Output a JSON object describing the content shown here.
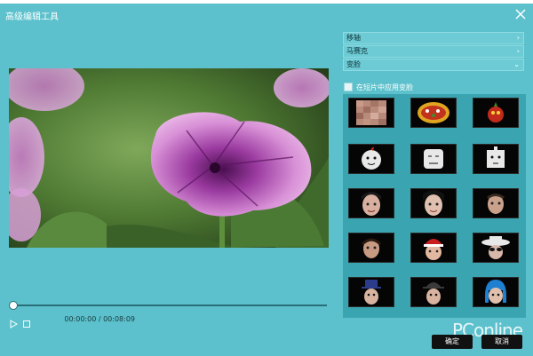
{
  "window": {
    "title": "高级编辑工具"
  },
  "player": {
    "time_display": "00:00:00 / 00:08:09",
    "progress": 0
  },
  "panel": {
    "sections": [
      {
        "label": "移轴",
        "icon": "chevron-right-icon",
        "expanded": false
      },
      {
        "label": "马赛克",
        "icon": "chevron-right-icon",
        "expanded": false
      },
      {
        "label": "变脸",
        "icon": "chevron-down-icon",
        "expanded": true
      }
    ],
    "apply_all_label": "在短片中应用变脸",
    "apply_all_checked": false
  },
  "effects": [
    {
      "name": "mosaic-face-effect"
    },
    {
      "name": "food-sticker-effect"
    },
    {
      "name": "cartoon-mask-effect"
    },
    {
      "name": "round-face-effect"
    },
    {
      "name": "square-face-effect"
    },
    {
      "name": "box-face-effect"
    },
    {
      "name": "face-swap-1-effect"
    },
    {
      "name": "face-swap-2-effect"
    },
    {
      "name": "face-swap-3-effect"
    },
    {
      "name": "face-swap-4-effect"
    },
    {
      "name": "santa-hat-effect"
    },
    {
      "name": "sunglasses-hat-effect"
    },
    {
      "name": "top-hat-effect"
    },
    {
      "name": "bowler-hat-effect"
    },
    {
      "name": "blue-hair-effect"
    }
  ],
  "footer": {
    "ok_label": "确定",
    "cancel_label": "取消",
    "watermark": "PConline"
  },
  "colors": {
    "window_bg": "#5cc1cc",
    "grid_bg": "#3aa5b1",
    "button_bg": "#111111"
  }
}
